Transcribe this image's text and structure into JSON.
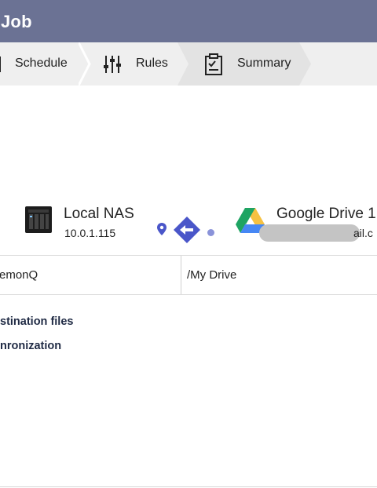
{
  "window": {
    "title": "Job"
  },
  "steps": [
    {
      "label": "Schedule",
      "icon": "calendar-icon",
      "state": "done"
    },
    {
      "label": "Rules",
      "icon": "sliders-icon",
      "state": "done"
    },
    {
      "label": "Summary",
      "icon": "clipboard-check-icon",
      "state": "active"
    }
  ],
  "source": {
    "name": "Local NAS",
    "address": "10.0.1.115",
    "icon": "nas-device-icon"
  },
  "direction": {
    "icon": "arrow-left-diamond-icon",
    "color": "#4a56c9"
  },
  "destination": {
    "name": "Google Drive 1",
    "account_visible_suffix": "ail.c",
    "icon": "google-drive-icon"
  },
  "paths": {
    "source_path": "emonQ",
    "destination_path": "/My Drive"
  },
  "options": [
    {
      "text": "stination files"
    },
    {
      "text": "nronization"
    }
  ],
  "colors": {
    "titlebar": "#6b7294",
    "steps_bg": "#efefef",
    "accent": "#4a56c9"
  }
}
